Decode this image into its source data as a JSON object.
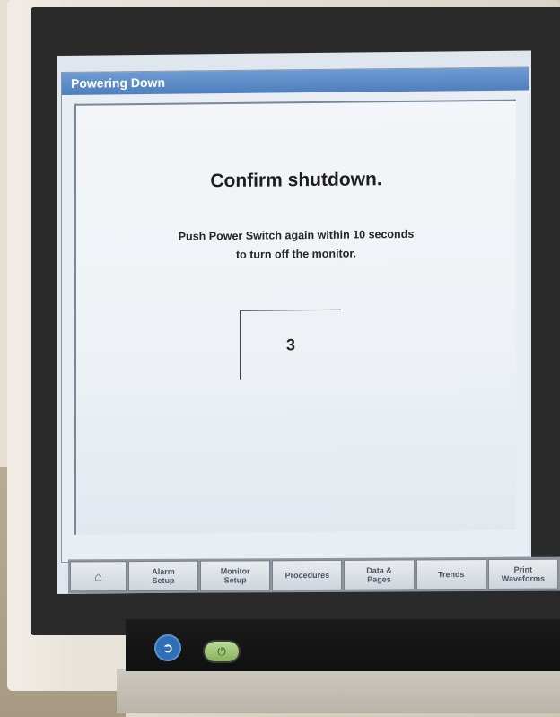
{
  "window": {
    "title": "Powering Down"
  },
  "dialog": {
    "heading": "Confirm shutdown.",
    "message_line1": "Push Power Switch again within 10 seconds",
    "message_line2": "to turn off the monitor.",
    "countdown": "3"
  },
  "taskbar": {
    "home_icon": "⌂",
    "buttons": [
      "Alarm\nSetup",
      "Monitor\nSetup",
      "Procedures",
      "Data &\nPages",
      "Trends",
      "Print\nWaveforms"
    ]
  },
  "hardware": {
    "knob_icon": "➲",
    "power_icon": "⏻"
  },
  "colors": {
    "titlebar": "#5a88c6",
    "power_button": "#9fc477",
    "knob": "#2f6fb6"
  }
}
